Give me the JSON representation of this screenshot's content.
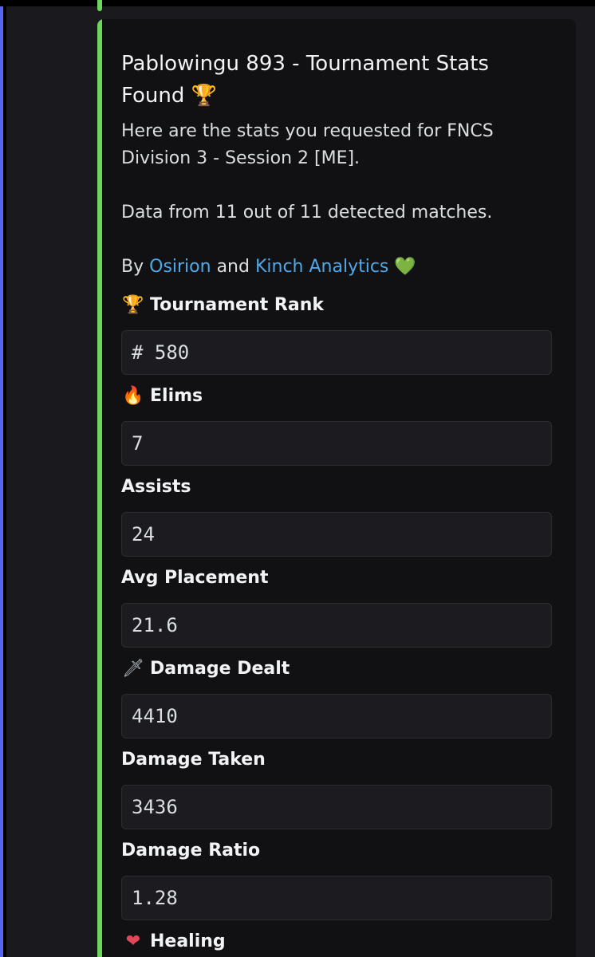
{
  "embed": {
    "accent_color": "#6ed55d",
    "title": "Pablowingu 893 - Tournament Stats Found",
    "title_icon": "trophy-icon",
    "description_line1": "Here are the stats you requested for FNCS Division 3 - Session 2 [ME].",
    "description_line2": "Data from 11 out of 11 detected matches.",
    "by_prefix": "By",
    "by_link1": "Osirion",
    "by_and": "and",
    "by_link2": "Kinch Analytics",
    "by_icon": "green-heart-icon",
    "link_color": "#4fa8e8"
  },
  "fields": [
    {
      "icon": "trophy-icon",
      "name": "Tournament Rank",
      "value": "# 580"
    },
    {
      "icon": "fire-icon",
      "name": "Elims",
      "value": "7"
    },
    {
      "icon": "",
      "name": "Assists",
      "value": "24"
    },
    {
      "icon": "",
      "name": "Avg Placement",
      "value": "21.6"
    },
    {
      "icon": "dagger-icon",
      "name": "Damage Dealt",
      "value": "4410"
    },
    {
      "icon": "",
      "name": "Damage Taken",
      "value": "3436"
    },
    {
      "icon": "",
      "name": "Damage Ratio",
      "value": "1.28"
    },
    {
      "icon": "mending-heart-icon",
      "name": "Healing",
      "value": ""
    }
  ]
}
